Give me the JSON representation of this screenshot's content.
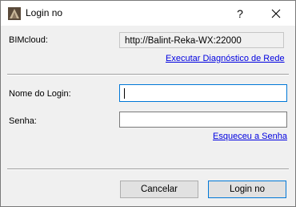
{
  "window": {
    "title": "Login no",
    "help_glyph": "?",
    "close_glyph": "✕",
    "icon": "bimcloud-app-icon"
  },
  "bimcloud": {
    "label": "BIMcloud:",
    "server_url": "http://Balint-Reka-WX:22000",
    "diagnostic_link": "Executar Diagnóstico de Rede"
  },
  "login": {
    "username_label": "Nome do Login:",
    "username_value": "",
    "password_label": "Senha:",
    "password_value": "",
    "forgot_link": "Esqueceu a Senha"
  },
  "buttons": {
    "cancel": "Cancelar",
    "login": "Login no"
  }
}
